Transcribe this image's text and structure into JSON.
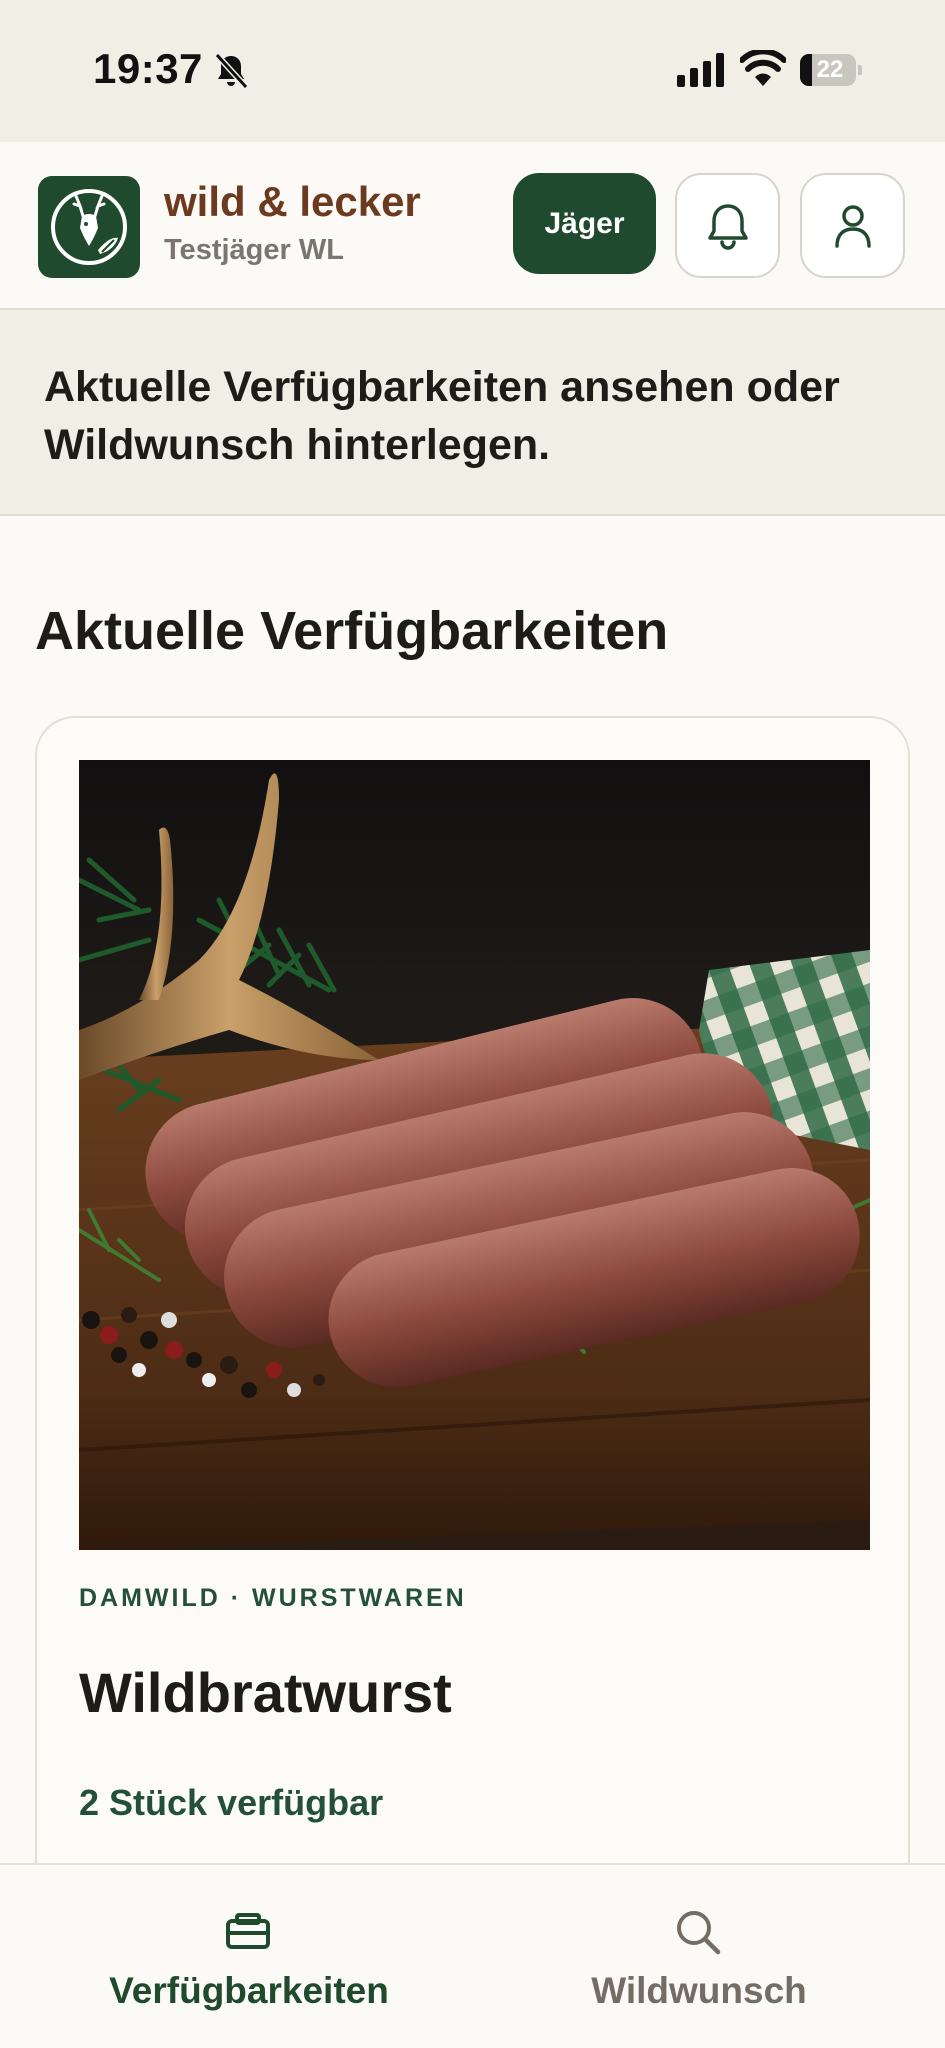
{
  "status_bar": {
    "time": "19:37",
    "battery_level": "22",
    "icons": [
      "bell-slash-icon",
      "cellular-signal-icon",
      "wifi-icon",
      "battery-icon"
    ]
  },
  "header": {
    "brand_title": "wild & lecker",
    "brand_subtitle": "Testjäger WL",
    "role_button_label": "Jäger",
    "notification_icon": "bell-icon",
    "profile_icon": "user-icon",
    "colors": {
      "brand_green": "#1f4a2e",
      "brand_brown": "#6b3a1f"
    }
  },
  "intro": {
    "text": "Aktuelle Verfügbarkeiten ansehen oder Wildwunsch hinterlegen."
  },
  "main": {
    "section_title": "Aktuelle Verfügbarkeiten",
    "products": [
      {
        "meta": "DAMWILD · WURSTWAREN",
        "name": "Wildbratwurst",
        "availability": "2 Stück verfügbar"
      }
    ]
  },
  "bottom_nav": {
    "items": [
      {
        "label": "Verfügbarkeiten",
        "icon": "availability-icon",
        "active": true
      },
      {
        "label": "Wildwunsch",
        "icon": "search-icon",
        "active": false
      }
    ]
  }
}
